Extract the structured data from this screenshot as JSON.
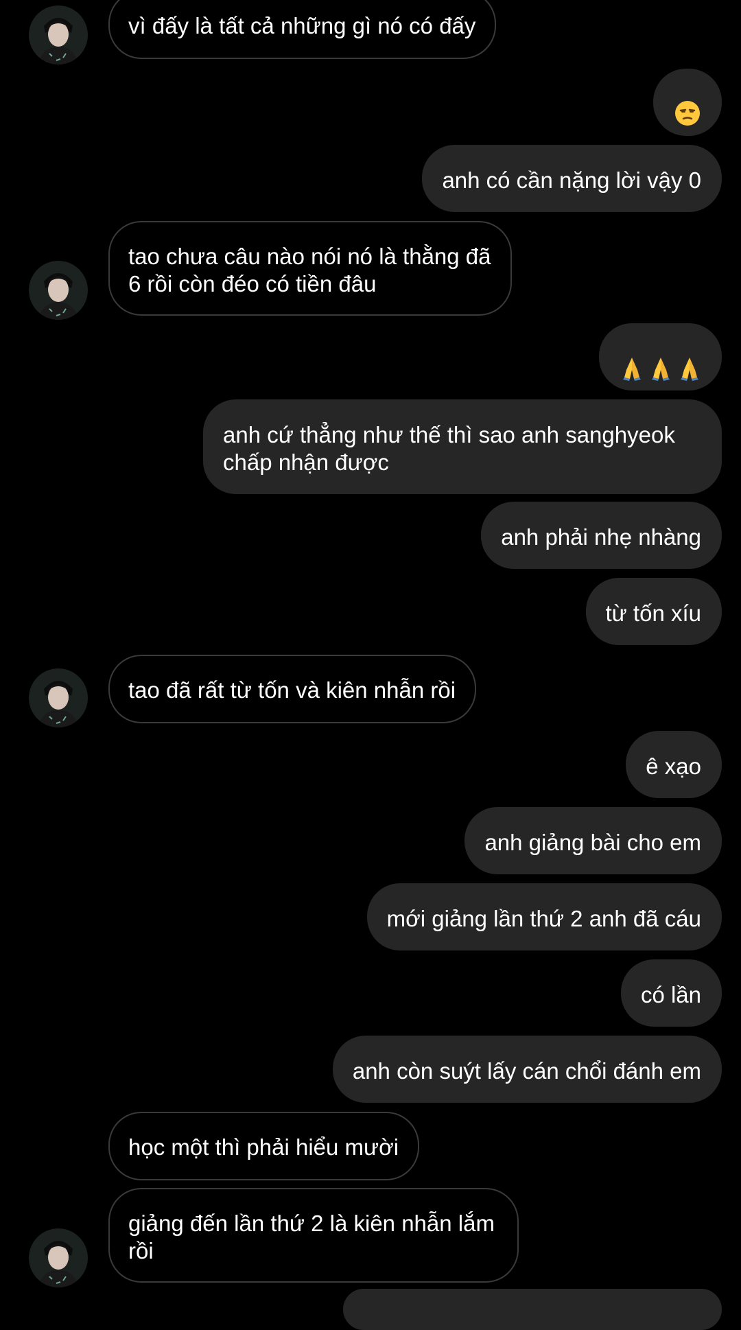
{
  "conversation": {
    "messages": [
      {
        "sender": "them",
        "text": "vì đấy là tất cả những gì nó có đấy"
      },
      {
        "sender": "me",
        "emoji": [
          "unamused-face-icon"
        ]
      },
      {
        "sender": "me",
        "text": "anh có cần nặng lời vậy 0"
      },
      {
        "sender": "them",
        "text": "tao chưa câu nào nói nó là thằng đã\n6 rồi còn đéo có tiền đâu"
      },
      {
        "sender": "me",
        "emoji": [
          "folded-hands-icon",
          "folded-hands-icon",
          "folded-hands-icon"
        ]
      },
      {
        "sender": "me",
        "text": "anh cứ thẳng như thế thì sao anh sanghyeok\nchấp nhận được"
      },
      {
        "sender": "me",
        "text": "anh phải nhẹ nhàng"
      },
      {
        "sender": "me",
        "text": "từ tốn xíu"
      },
      {
        "sender": "them",
        "text": "tao đã rất từ tốn và kiên nhẫn rồi"
      },
      {
        "sender": "me",
        "text": "ê xạo"
      },
      {
        "sender": "me",
        "text": "anh giảng bài cho em"
      },
      {
        "sender": "me",
        "text": "mới giảng lần thứ 2 anh đã cáu"
      },
      {
        "sender": "me",
        "text": "có lần"
      },
      {
        "sender": "me",
        "text": "anh còn suýt lấy cán chổi đánh em"
      },
      {
        "sender": "them",
        "text": "học một thì phải hiểu mười"
      },
      {
        "sender": "them",
        "text": "giảng đến lần thứ 2 là kiên nhẫn lắm\nrồi"
      }
    ]
  },
  "colors": {
    "background": "#000000",
    "outgoing_bubble": "#262626",
    "incoming_border": "#3a3a3a",
    "text": "#ffffff"
  }
}
